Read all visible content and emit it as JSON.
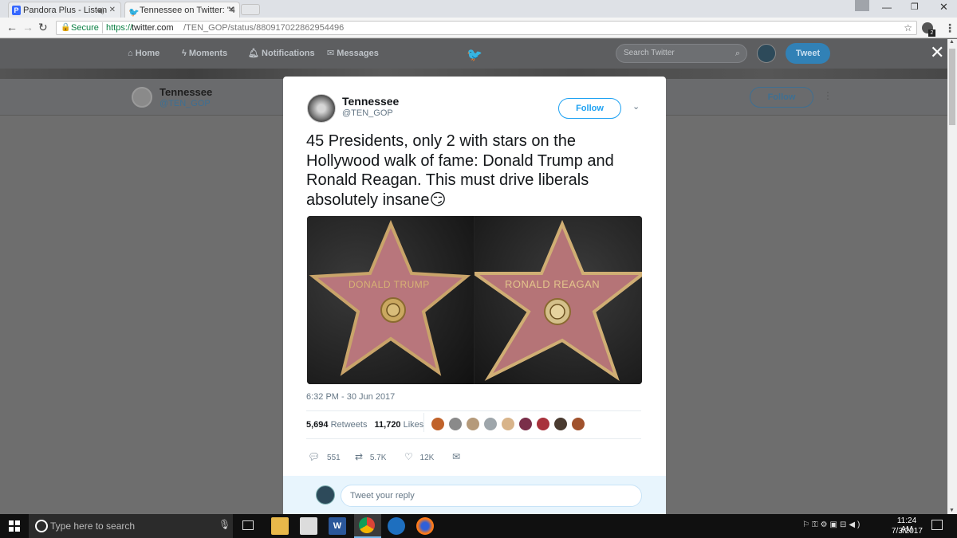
{
  "browser": {
    "tabs": [
      {
        "label": "Pandora Plus - Listen",
        "icon": "pandora-icon"
      },
      {
        "label": "Tennessee on Twitter: \"4",
        "icon": "twitter-bird-icon"
      }
    ],
    "secure_label": "Secure",
    "url_prefix": "https://",
    "url_host": "twitter.com",
    "url_path": "/TEN_GOP/status/880917022862954496",
    "extension_badge": "2"
  },
  "twitter_nav": {
    "home": "Home",
    "moments": "Moments",
    "notifications": "Notifications",
    "messages": "Messages",
    "search_placeholder": "Search Twitter",
    "tweet_button": "Tweet"
  },
  "profile_bar": {
    "name": "Tennessee",
    "handle": "@TEN_GOP",
    "follow": "Follow"
  },
  "tweet": {
    "author_name": "Tennessee",
    "author_handle": "@TEN_GOP",
    "follow_label": "Follow",
    "text_line1": "45 Presidents, only 2 with stars on the",
    "text_line2": "Hollywood walk of fame: Donald Trump and",
    "text_line3": "Ronald Reagan. This must drive liberals",
    "text_line4": "absolutely insane",
    "emoji": "😏",
    "images": [
      {
        "star_name": "DONALD TRUMP"
      },
      {
        "star_name": "RONALD REAGAN"
      }
    ],
    "timestamp": "6:32 PM - 30 Jun 2017",
    "retweets_count": "5,694",
    "retweets_label": "Retweets",
    "likes_count": "11,720",
    "likes_label": "Likes",
    "liker_colors": [
      "#c0622a",
      "#8a8a8a",
      "#b59a7a",
      "#9ea6ab",
      "#d8b48a",
      "#7a2f4a",
      "#a8323c",
      "#4a3b30",
      "#a0522d"
    ],
    "actions": {
      "replies": "551",
      "retweets": "5.7K",
      "likes": "12K"
    },
    "reply_placeholder": "Tweet your reply"
  },
  "taskbar": {
    "search_placeholder": "Type here to search",
    "time": "11:24 AM",
    "date": "7/3/2017"
  }
}
